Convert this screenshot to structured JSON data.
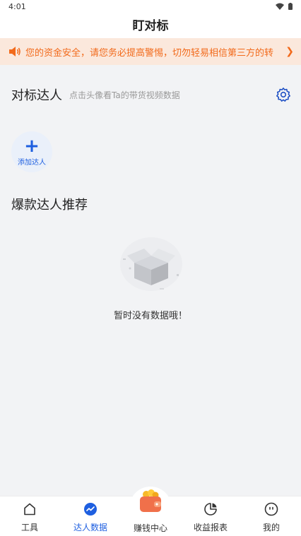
{
  "status_bar": {
    "time": "4:01"
  },
  "header": {
    "title": "盯对标"
  },
  "notice": {
    "text": "您的资金安全，请您务必提高警惕，切勿轻易相信第三方的转"
  },
  "benchmark": {
    "title": "对标达人",
    "subtitle": "点击头像看Ta的带货视频数据",
    "add_label": "添加达人"
  },
  "recommend": {
    "title": "爆款达人推荐",
    "empty_text": "暂时没有数据哦！"
  },
  "tabs": [
    {
      "label": "工具",
      "icon": "home-icon"
    },
    {
      "label": "达人数据",
      "icon": "trend-chat-icon"
    },
    {
      "label": "赚钱中心",
      "icon": "wallet-coin-icon"
    },
    {
      "label": "收益报表",
      "icon": "pie-chart-icon"
    },
    {
      "label": "我的",
      "icon": "face-icon"
    }
  ],
  "colors": {
    "accent": "#1e5fe0",
    "notice_text": "#f26a1b",
    "notice_bg": "#fbe8dc",
    "page_bg": "#f2f3f5"
  }
}
